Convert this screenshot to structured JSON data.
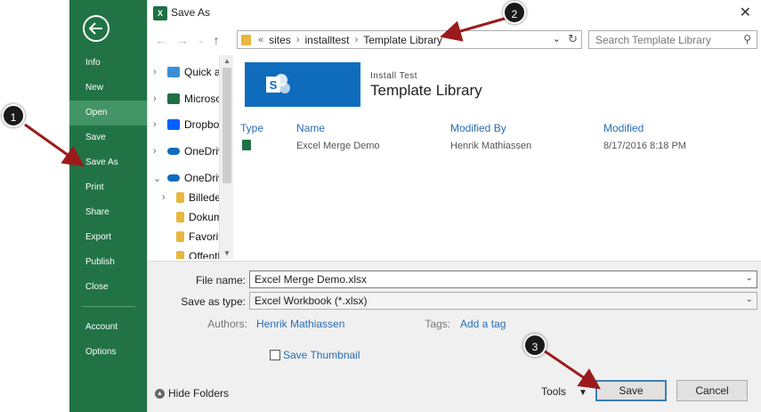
{
  "backstage": {
    "items": [
      "Info",
      "New",
      "Open",
      "Save",
      "Save As",
      "Print",
      "Share",
      "Export",
      "Publish",
      "Close",
      "Account",
      "Options"
    ],
    "active_item": "Open",
    "accent_color": "#217346"
  },
  "dialog": {
    "title": "Save As",
    "title_icon": "excel-icon",
    "address": {
      "prefix": "«",
      "segments": [
        "sites",
        "installtest",
        "Template Library"
      ]
    },
    "search_placeholder": "Search Template Library",
    "nav_pane": {
      "items": [
        {
          "label": "Quick ac",
          "icon": "quick-access-star-icon"
        },
        {
          "label": "Microso",
          "icon": "excel-icon"
        },
        {
          "label": "Dropbox",
          "icon": "dropbox-icon"
        },
        {
          "label": "OneDriv",
          "icon": "onedrive-cloud-icon"
        },
        {
          "label": "OneDriv",
          "icon": "onedrive-cloud-icon"
        },
        {
          "label": "Billede",
          "icon": "folder-icon"
        },
        {
          "label": "Dokum",
          "icon": "folder-icon"
        },
        {
          "label": "Favorit",
          "icon": "folder-icon"
        },
        {
          "label": "Offentl",
          "icon": "folder-icon"
        }
      ]
    },
    "sharepoint": {
      "subtitle": "Install Test",
      "title": "Template Library",
      "logo_letter": "S"
    },
    "columns": [
      "Type",
      "Name",
      "Modified By",
      "Modified"
    ],
    "files": [
      {
        "name": "Excel Merge Demo",
        "modified_by": "Henrik Mathiassen",
        "modified": "8/17/2016 8:18 PM"
      }
    ],
    "form": {
      "file_name_label": "File name:",
      "file_name_value": "Excel Merge Demo.xlsx",
      "save_as_type_label": "Save as type:",
      "save_as_type_value": "Excel Workbook (*.xlsx)",
      "authors_label": "Authors:",
      "authors_value": "Henrik Mathiassen",
      "tags_label": "Tags:",
      "tags_value": "Add a tag",
      "thumbnail_label": "Save Thumbnail",
      "hide_folders_label": "Hide Folders",
      "tools_label": "Tools",
      "save_label": "Save",
      "cancel_label": "Cancel"
    }
  },
  "annotations": [
    "1",
    "2",
    "3"
  ],
  "annotation_arrow_color": "#9b1b1b"
}
